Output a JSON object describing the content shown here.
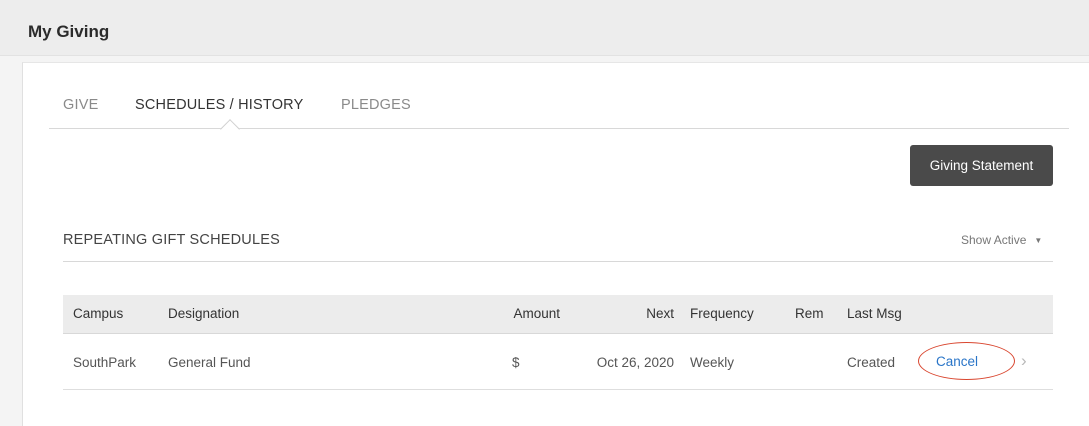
{
  "header": {
    "title": "My Giving"
  },
  "tabs": [
    {
      "label": "GIVE",
      "active": false
    },
    {
      "label": "SCHEDULES / HISTORY",
      "active": true
    },
    {
      "label": "PLEDGES",
      "active": false
    }
  ],
  "toolbar": {
    "statement_label": "Giving Statement"
  },
  "section": {
    "title": "REPEATING GIFT SCHEDULES",
    "filter_label": "Show Active",
    "filter_icon": "caret-down-icon"
  },
  "table": {
    "columns": [
      "Campus",
      "Designation",
      "Amount",
      "Next",
      "Frequency",
      "Rem",
      "Last Msg"
    ],
    "rows": [
      {
        "campus": "SouthPark",
        "designation": "General Fund",
        "amount": "$",
        "next": "Oct 26, 2020",
        "frequency": "Weekly",
        "rem": "",
        "last_msg": "Created",
        "action_label": "Cancel",
        "row_icon": "chevron-right-icon"
      }
    ]
  },
  "colors": {
    "button_bg": "#4a4a4a",
    "link": "#2a75c8",
    "highlight_circle": "#d9462f"
  }
}
